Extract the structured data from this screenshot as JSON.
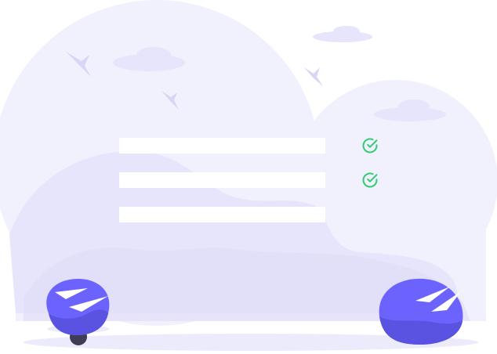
{
  "illustration": {
    "colors": {
      "background": "#ffffff",
      "cloud_light": "#f1f0fd",
      "cloud_mid": "#e7e5fb",
      "cloud_deep": "#dedbf8",
      "bush_primary": "#6c63ff",
      "bush_dark": "#5a52e0",
      "bush_highlight": "#ffffff",
      "ground_shadow": "#ecebfb",
      "bird": "#d9d6f5",
      "form_bar": "#ffffff",
      "check": "#2ecc71",
      "wheel": "#3f3d56"
    },
    "form": {
      "fields": [
        {
          "state": "checked"
        },
        {
          "state": "checked"
        },
        {
          "state": "empty"
        }
      ]
    },
    "icons": [
      "check-circle-icon",
      "bird-icon",
      "cloud-icon",
      "bush-icon"
    ]
  }
}
